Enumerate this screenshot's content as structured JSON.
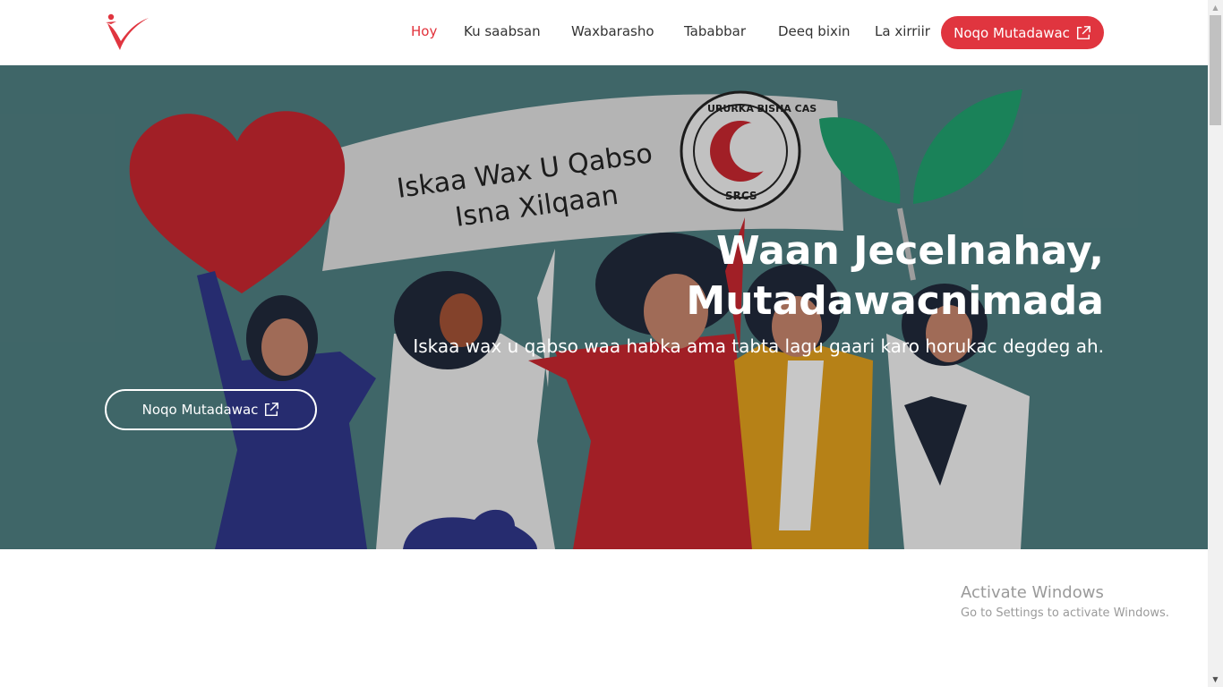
{
  "header": {
    "logo_icon": "volunteer-v-logo-icon",
    "nav": [
      {
        "label": "Hoy",
        "active": true
      },
      {
        "label": "Ku saabsan",
        "active": false
      },
      {
        "label": "Waxbarasho",
        "active": false
      },
      {
        "label": "Tababbar",
        "active": false
      },
      {
        "label": "Deeq bixin",
        "active": false
      },
      {
        "label": "La xirriir",
        "active": false
      }
    ],
    "cta_label": "Noqo Mutadawac",
    "cta_icon": "external-link-icon"
  },
  "hero": {
    "banner_line1": "Iskaa Wax U Qabso",
    "banner_line2": "Isna Xilqaan",
    "emblem_ring_text": "URURKA BISHA CAS",
    "emblem_code": "SRCS",
    "title_line1": "Waan Jecelnahay,",
    "title_line2": "Mutadawacnimada",
    "subtitle": "Iskaa wax u qabso waa habka ama tabta lagu gaari karo horukac degdeg ah.",
    "cta_label": "Noqo Mutadawac",
    "cta_icon": "external-link-icon"
  },
  "watermark": {
    "title": "Activate Windows",
    "subtitle": "Go to Settings to activate Windows."
  },
  "colors": {
    "accent": "#e0353f",
    "hero_bg": "#4c7a7c",
    "nav_text": "#333333"
  }
}
